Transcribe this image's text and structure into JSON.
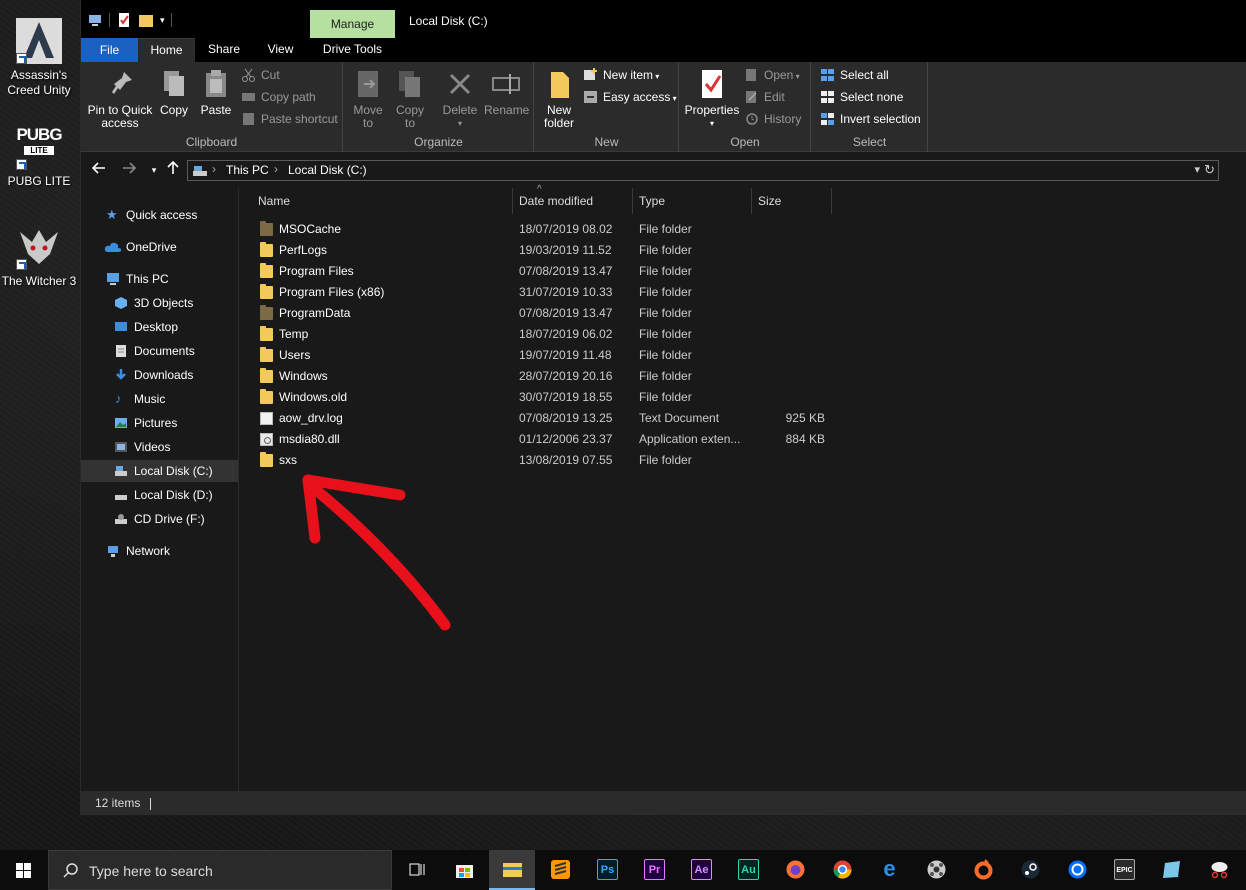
{
  "desktop": {
    "icons": [
      {
        "label_line1": "Assassin's",
        "label_line2": "Creed Unity",
        "icon": "assassins-creed-icon"
      },
      {
        "label_line1": "PUBG LITE",
        "label_line2": "",
        "icon": "pubg-lite-icon"
      },
      {
        "label_line1": "The Witcher 3",
        "label_line2": "",
        "icon": "witcher-icon"
      }
    ],
    "pubg_logo_top": "PUBG",
    "pubg_logo_bottom": "LITE"
  },
  "window": {
    "title": "Local Disk (C:)",
    "manage_label": "Manage",
    "tabs": {
      "file": "File",
      "home": "Home",
      "share": "Share",
      "view": "View",
      "drive_tools": "Drive Tools"
    }
  },
  "ribbon": {
    "clipboard": {
      "label": "Clipboard",
      "pin_line1": "Pin to Quick",
      "pin_line2": "access",
      "copy": "Copy",
      "paste": "Paste",
      "cut": "Cut",
      "copy_path": "Copy path",
      "paste_shortcut": "Paste shortcut"
    },
    "organize": {
      "label": "Organize",
      "move_line1": "Move",
      "move_line2": "to",
      "copy_line1": "Copy",
      "copy_line2": "to",
      "delete": "Delete",
      "rename": "Rename"
    },
    "new": {
      "label": "New",
      "new_folder_line1": "New",
      "new_folder_line2": "folder",
      "new_item": "New item",
      "easy_access": "Easy access"
    },
    "open": {
      "label": "Open",
      "properties": "Properties",
      "open": "Open",
      "edit": "Edit",
      "history": "History"
    },
    "select": {
      "label": "Select",
      "select_all": "Select all",
      "select_none": "Select none",
      "invert": "Invert selection"
    }
  },
  "address": {
    "crumbs": [
      "This PC",
      "Local Disk (C:)"
    ]
  },
  "nav": [
    {
      "label": "Quick access",
      "icon": "star-icon",
      "level": 0,
      "selected": false
    },
    {
      "label": "OneDrive",
      "icon": "cloud-icon",
      "level": 0,
      "selected": false
    },
    {
      "label": "This PC",
      "icon": "computer-icon",
      "level": 0,
      "selected": false
    },
    {
      "label": "3D Objects",
      "icon": "cube-icon",
      "level": 1,
      "selected": false
    },
    {
      "label": "Desktop",
      "icon": "desktop-icon",
      "level": 1,
      "selected": false
    },
    {
      "label": "Documents",
      "icon": "documents-icon",
      "level": 1,
      "selected": false
    },
    {
      "label": "Downloads",
      "icon": "download-icon",
      "level": 1,
      "selected": false
    },
    {
      "label": "Music",
      "icon": "music-icon",
      "level": 1,
      "selected": false
    },
    {
      "label": "Pictures",
      "icon": "pictures-icon",
      "level": 1,
      "selected": false
    },
    {
      "label": "Videos",
      "icon": "videos-icon",
      "level": 1,
      "selected": false
    },
    {
      "label": "Local Disk (C:)",
      "icon": "drive-icon",
      "level": 1,
      "selected": true
    },
    {
      "label": "Local Disk (D:)",
      "icon": "drive-icon",
      "level": 1,
      "selected": false
    },
    {
      "label": "CD Drive (F:)",
      "icon": "cd-drive-icon",
      "level": 1,
      "selected": false
    },
    {
      "label": "Network",
      "icon": "network-icon",
      "level": 0,
      "selected": false
    }
  ],
  "columns": {
    "name": "Name",
    "date": "Date modified",
    "type": "Type",
    "size": "Size"
  },
  "files": [
    {
      "name": "MSOCache",
      "date": "18/07/2019 08.02",
      "type": "File folder",
      "size": "",
      "kind": "folder-system"
    },
    {
      "name": "PerfLogs",
      "date": "19/03/2019 11.52",
      "type": "File folder",
      "size": "",
      "kind": "folder"
    },
    {
      "name": "Program Files",
      "date": "07/08/2019 13.47",
      "type": "File folder",
      "size": "",
      "kind": "folder"
    },
    {
      "name": "Program Files (x86)",
      "date": "31/07/2019 10.33",
      "type": "File folder",
      "size": "",
      "kind": "folder"
    },
    {
      "name": "ProgramData",
      "date": "07/08/2019 13.47",
      "type": "File folder",
      "size": "",
      "kind": "folder-system"
    },
    {
      "name": "Temp",
      "date": "18/07/2019 06.02",
      "type": "File folder",
      "size": "",
      "kind": "folder"
    },
    {
      "name": "Users",
      "date": "19/07/2019 11.48",
      "type": "File folder",
      "size": "",
      "kind": "folder"
    },
    {
      "name": "Windows",
      "date": "28/07/2019 20.16",
      "type": "File folder",
      "size": "",
      "kind": "folder"
    },
    {
      "name": "Windows.old",
      "date": "30/07/2019 18.55",
      "type": "File folder",
      "size": "",
      "kind": "folder"
    },
    {
      "name": "aow_drv.log",
      "date": "07/08/2019 13.25",
      "type": "Text Document",
      "size": "925 KB",
      "kind": "doc"
    },
    {
      "name": "msdia80.dll",
      "date": "01/12/2006 23.37",
      "type": "Application exten...",
      "size": "884 KB",
      "kind": "dll"
    },
    {
      "name": "sxs",
      "date": "13/08/2019 07.55",
      "type": "File folder",
      "size": "",
      "kind": "folder"
    }
  ],
  "status": {
    "items": "12 items"
  },
  "taskbar": {
    "search_placeholder": "Type here to search",
    "apps": [
      {
        "icon": "task-view-icon",
        "label": ""
      },
      {
        "icon": "store-icon",
        "label": ""
      },
      {
        "icon": "file-explorer-icon",
        "label": ""
      },
      {
        "icon": "sublime-text-icon",
        "label": ""
      },
      {
        "icon": "photoshop-icon",
        "label": "Ps"
      },
      {
        "icon": "premiere-icon",
        "label": "Pr"
      },
      {
        "icon": "after-effects-icon",
        "label": "Ae"
      },
      {
        "icon": "audition-icon",
        "label": "Au"
      },
      {
        "icon": "firefox-icon",
        "label": ""
      },
      {
        "icon": "chrome-icon",
        "label": ""
      },
      {
        "icon": "edge-icon",
        "label": "e"
      },
      {
        "icon": "media-player-icon",
        "label": ""
      },
      {
        "icon": "origin-icon",
        "label": ""
      },
      {
        "icon": "steam-icon",
        "label": ""
      },
      {
        "icon": "uplay-icon",
        "label": ""
      },
      {
        "icon": "epic-games-icon",
        "label": "EPIC"
      },
      {
        "icon": "app-icon",
        "label": ""
      },
      {
        "icon": "snipping-tool-icon",
        "label": ""
      }
    ]
  },
  "colors": {
    "accent": "#1a62c2",
    "manage_tab": "#b5e0a0",
    "folder": "#f3c95b",
    "annotation_arrow": "#e8111b"
  }
}
